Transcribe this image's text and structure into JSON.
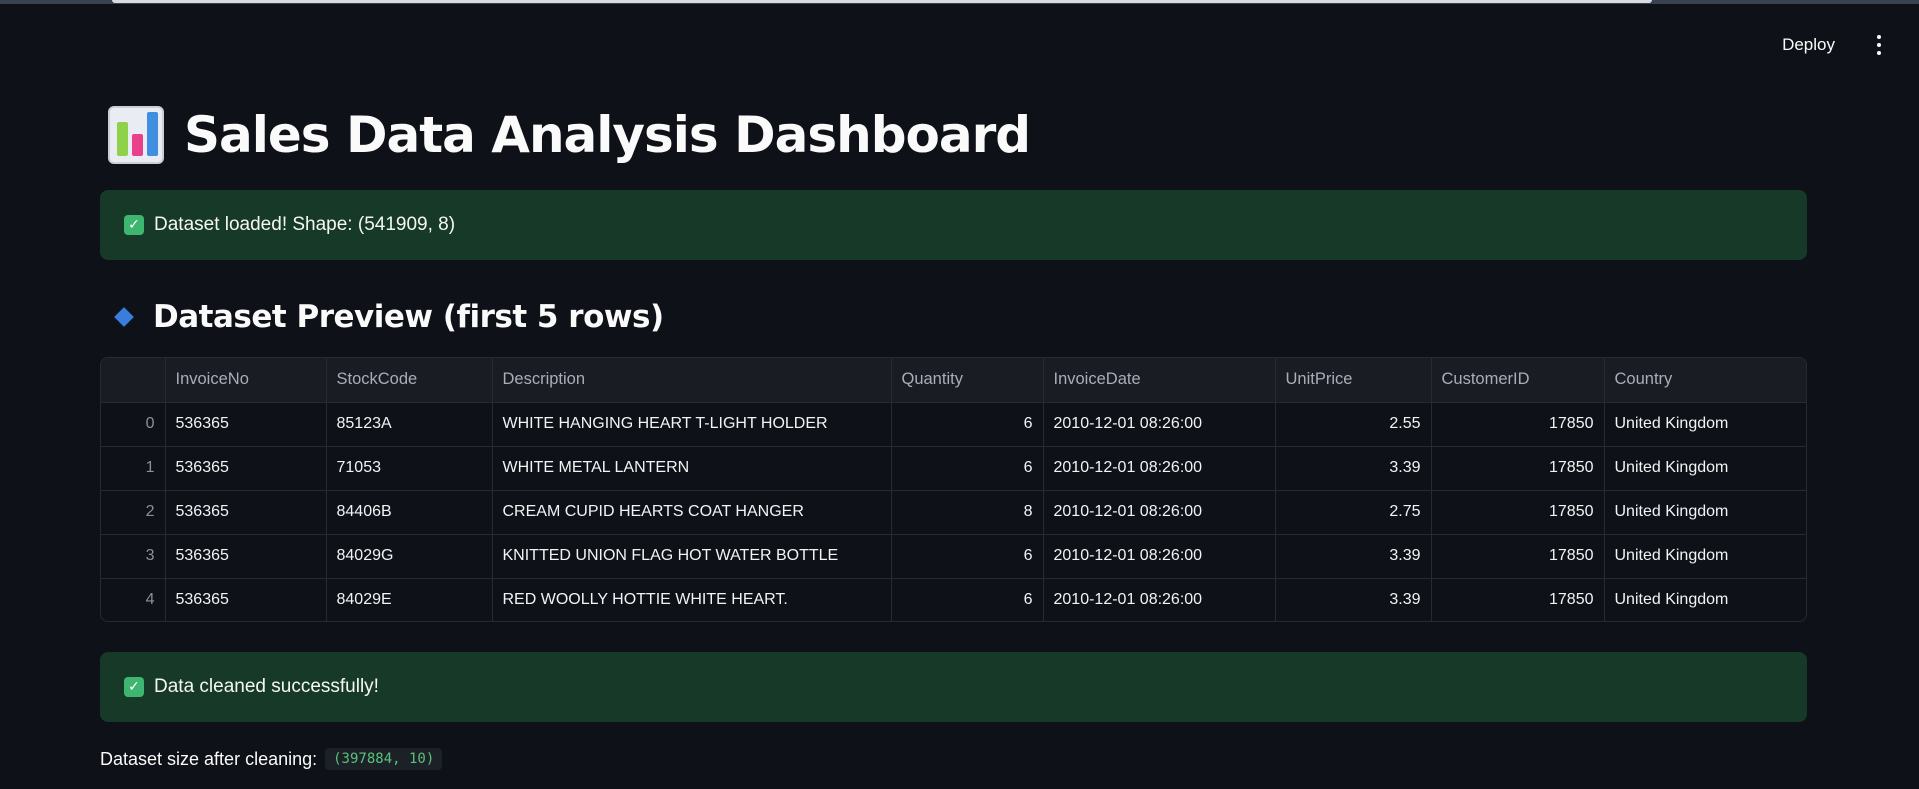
{
  "toolbar": {
    "deploy_label": "Deploy"
  },
  "header": {
    "title": "Sales Data Analysis Dashboard"
  },
  "alerts": {
    "loaded": "Dataset loaded! Shape: (541909, 8)",
    "cleaned": "Data cleaned successfully!"
  },
  "preview": {
    "subheader": "Dataset Preview (first 5 rows)",
    "columns": [
      "",
      "InvoiceNo",
      "StockCode",
      "Description",
      "Quantity",
      "InvoiceDate",
      "UnitPrice",
      "CustomerID",
      "Country"
    ],
    "rows": [
      [
        "0",
        "536365",
        "85123A",
        "WHITE HANGING HEART T-LIGHT HOLDER",
        "6",
        "2010-12-01 08:26:00",
        "2.55",
        "17850",
        "United Kingdom"
      ],
      [
        "1",
        "536365",
        "71053",
        "WHITE METAL LANTERN",
        "6",
        "2010-12-01 08:26:00",
        "3.39",
        "17850",
        "United Kingdom"
      ],
      [
        "2",
        "536365",
        "84406B",
        "CREAM CUPID HEARTS COAT HANGER",
        "8",
        "2010-12-01 08:26:00",
        "2.75",
        "17850",
        "United Kingdom"
      ],
      [
        "3",
        "536365",
        "84029G",
        "KNITTED UNION FLAG HOT WATER BOTTLE",
        "6",
        "2010-12-01 08:26:00",
        "3.39",
        "17850",
        "United Kingdom"
      ],
      [
        "4",
        "536365",
        "84029E",
        "RED WOOLLY HOTTIE WHITE HEART.",
        "6",
        "2010-12-01 08:26:00",
        "3.39",
        "17850",
        "United Kingdom"
      ]
    ]
  },
  "footer": {
    "label": "Dataset size after cleaning:",
    "value": "(397884, 10)"
  },
  "colors": {
    "background": "#0e1117",
    "success_bg": "#173928",
    "accent_blue": "#3b7ddd",
    "code_green": "#5bc17a"
  },
  "icons": {
    "title": "bar-chart-icon",
    "alert": "check-mark-icon",
    "subheader": "blue-diamond-icon",
    "menu": "kebab-menu-icon"
  }
}
